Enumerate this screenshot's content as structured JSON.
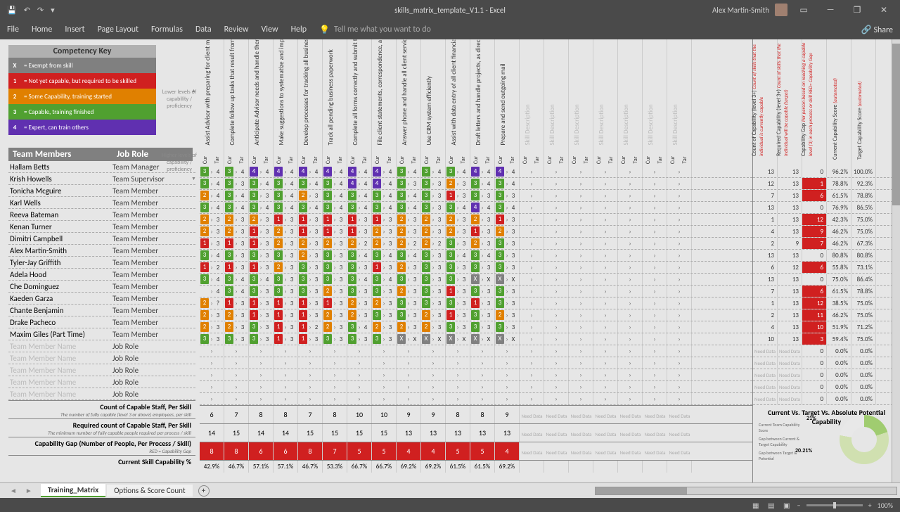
{
  "app": {
    "title": "skills_matrix_template_V1.1 - Excel",
    "user": "Alex Martin-Smith"
  },
  "qat": {
    "save": "💾",
    "undo": "↶",
    "redo": "↷"
  },
  "win": {
    "min": "—",
    "max": "❐",
    "close": "✕",
    "opts": "▭"
  },
  "ribbon": {
    "tabs": [
      "File",
      "Home",
      "Insert",
      "Page Layout",
      "Formulas",
      "Data",
      "Review",
      "View",
      "Help"
    ],
    "tell": "Tell me what you want to do",
    "share": "Share"
  },
  "key": {
    "header": "Competency Key",
    "rows": [
      {
        "n": "X",
        "txt": "= Exempt from skill"
      },
      {
        "n": "1",
        "txt": "= Not yet capable, but required to be skilled"
      },
      {
        "n": "2",
        "txt": "= Some Capability, training started"
      },
      {
        "n": "3",
        "txt": "= Capable, training finished"
      },
      {
        "n": "4",
        "txt": "= Expert, can train others"
      }
    ],
    "prof_low": "Lower levels of capability / proficiency",
    "prof_high": "Higher levels of capability / proficiency"
  },
  "members_hdr": {
    "c1": "Team Members",
    "c2": "Job Role"
  },
  "members": [
    {
      "name": "Hallam Betts",
      "role": "Team Manager"
    },
    {
      "name": "Krish Howells",
      "role": "Team Supervisor"
    },
    {
      "name": "Tonicha Mcguire",
      "role": "Team Member"
    },
    {
      "name": "Karl Wells",
      "role": "Team Member"
    },
    {
      "name": "Reeva Bateman",
      "role": "Team Member"
    },
    {
      "name": "Kenan Turner",
      "role": "Team Member"
    },
    {
      "name": "Dimitri Campbell",
      "role": "Team Member"
    },
    {
      "name": "Alex Martin-Smith",
      "role": "Team Member"
    },
    {
      "name": "Tyler-Jay Griffith",
      "role": "Team Member"
    },
    {
      "name": "Adela Hood",
      "role": "Team Member"
    },
    {
      "name": "Che Dominguez",
      "role": "Team Member"
    },
    {
      "name": "Kaeden Garza",
      "role": "Team Member"
    },
    {
      "name": "Chante Benjamin",
      "role": "Team Member"
    },
    {
      "name": "Drake Pacheco",
      "role": "Team Member"
    },
    {
      "name": "Maxim Giles (Part Time)",
      "role": "Team Member"
    }
  ],
  "placeholder_member": "Team Member Name",
  "placeholder_role": "Job Role",
  "skills": [
    "Assist Advisor with preparing for client meetings",
    "Complete follow up tasks that result from Client meetings",
    "Anticipate Advisor needs and handle them proactively",
    "Make suggestions to systematize and improve office functions",
    "Develop processes for tracking all business and handling paperwork",
    "Track all pending business paperwork",
    "Complete all forms correctly and submit them within one business day",
    "File client statements, correspondence, and agreements",
    "Answer phone and handle all client service issues within capacity",
    "Use CRM system efficiently",
    "Assist with data entry of all client financial information",
    "Draft letters and handle projects, as directed by Advisor",
    "Prepare and send outgoing mail"
  ],
  "skill_placeholder": "Skill Description",
  "curt": {
    "c": "Cur",
    "t": "Tar"
  },
  "matrix": [
    [
      {
        "c": 3,
        "t": 4
      },
      {
        "c": 3,
        "t": 4
      },
      {
        "c": 4,
        "t": 4
      },
      {
        "c": 4,
        "t": 4
      },
      {
        "c": 4,
        "t": 4
      },
      {
        "c": 4,
        "t": 4
      },
      {
        "c": 4,
        "t": 4
      },
      {
        "c": 4,
        "t": 4
      },
      {
        "c": 3,
        "t": 4
      },
      {
        "c": 3,
        "t": 4
      },
      {
        "c": 3,
        "t": 4
      },
      {
        "c": 4,
        "t": 4
      },
      {
        "c": 4,
        "t": 4
      }
    ],
    [
      {
        "c": 3,
        "t": 4
      },
      {
        "c": 3,
        "t": 3
      },
      {
        "c": 3,
        "t": 4
      },
      {
        "c": 3,
        "t": 4
      },
      {
        "c": 3,
        "t": 4
      },
      {
        "c": 3,
        "t": 4
      },
      {
        "c": 4,
        "t": 4
      },
      {
        "c": 4,
        "t": 4
      },
      {
        "c": 3,
        "t": 3
      },
      {
        "c": 3,
        "t": 3
      },
      {
        "c": 2,
        "t": 3
      },
      {
        "c": 3,
        "t": 4
      },
      {
        "c": 3,
        "t": 4
      }
    ],
    [
      {
        "c": 2,
        "t": 4
      },
      {
        "c": 3,
        "t": 4
      },
      {
        "c": 3,
        "t": 3
      },
      {
        "c": 3,
        "t": 4
      },
      {
        "c": 2,
        "t": 3
      },
      {
        "c": 3,
        "t": 4
      },
      {
        "c": 3,
        "t": 4
      },
      {
        "c": 3,
        "t": 4
      },
      {
        "c": 3,
        "t": 4
      },
      {
        "c": 3,
        "t": 3
      },
      {
        "c": 1,
        "t": 3
      },
      {
        "c": 3,
        "t": 3
      },
      {
        "c": 3,
        "t": 3
      }
    ],
    [
      {
        "c": 3,
        "t": 4
      },
      {
        "c": 3,
        "t": 4
      },
      {
        "c": 3,
        "t": 4
      },
      {
        "c": 3,
        "t": 4
      },
      {
        "c": 3,
        "t": 4
      },
      {
        "c": 3,
        "t": 4
      },
      {
        "c": 3,
        "t": 4
      },
      {
        "c": 3,
        "t": 4
      },
      {
        "c": 3,
        "t": 4
      },
      {
        "c": 3,
        "t": 3
      },
      {
        "c": 3,
        "t": 4
      },
      {
        "c": 4,
        "t": 4
      },
      {
        "c": 3,
        "t": 4
      }
    ],
    [
      {
        "c": 2,
        "t": 3
      },
      {
        "c": 2,
        "t": 3
      },
      {
        "c": 2,
        "t": 3
      },
      {
        "c": 1,
        "t": 3
      },
      {
        "c": 1,
        "t": 3
      },
      {
        "c": 1,
        "t": 3
      },
      {
        "c": 1,
        "t": 3
      },
      {
        "c": 1,
        "t": 3
      },
      {
        "c": 2,
        "t": 3
      },
      {
        "c": 2,
        "t": 3
      },
      {
        "c": 2,
        "t": 3
      },
      {
        "c": 2,
        "t": 3
      },
      {
        "c": 1,
        "t": 3
      }
    ],
    [
      {
        "c": 2,
        "t": 3
      },
      {
        "c": 2,
        "t": 3
      },
      {
        "c": 1,
        "t": 3
      },
      {
        "c": 2,
        "t": 3
      },
      {
        "c": 1,
        "t": 3
      },
      {
        "c": 1,
        "t": 3
      },
      {
        "c": 1,
        "t": 3
      },
      {
        "c": 2,
        "t": 3
      },
      {
        "c": 2,
        "t": 3
      },
      {
        "c": 2,
        "t": 3
      },
      {
        "c": 2,
        "t": 3
      },
      {
        "c": 1,
        "t": 3
      },
      {
        "c": 2,
        "t": 3
      }
    ],
    [
      {
        "c": 1,
        "t": 3
      },
      {
        "c": 1,
        "t": 3
      },
      {
        "c": 1,
        "t": 3
      },
      {
        "c": 2,
        "t": 3
      },
      {
        "c": 2,
        "t": 3
      },
      {
        "c": 2,
        "t": 3
      },
      {
        "c": 2,
        "t": 2
      },
      {
        "c": 2,
        "t": 3
      },
      {
        "c": 2,
        "t": 2
      },
      {
        "c": 2,
        "t": 2
      },
      {
        "c": 3,
        "t": 3
      },
      {
        "c": 2,
        "t": 3
      },
      {
        "c": 3,
        "t": 3
      }
    ],
    [
      {
        "c": 3,
        "t": 4
      },
      {
        "c": 3,
        "t": 3
      },
      {
        "c": 3,
        "t": 3
      },
      {
        "c": 3,
        "t": 3
      },
      {
        "c": 2,
        "t": 3
      },
      {
        "c": 3,
        "t": 3
      },
      {
        "c": 3,
        "t": 4
      },
      {
        "c": 3,
        "t": 4
      },
      {
        "c": 3,
        "t": 4
      },
      {
        "c": 3,
        "t": 3
      },
      {
        "c": 3,
        "t": 4
      },
      {
        "c": 3,
        "t": 4
      },
      {
        "c": 3,
        "t": 3
      }
    ],
    [
      {
        "c": 1,
        "t": 2
      },
      {
        "c": 1,
        "t": 3
      },
      {
        "c": 1,
        "t": 3
      },
      {
        "c": 2,
        "t": 3
      },
      {
        "c": 3,
        "t": 3
      },
      {
        "c": 3,
        "t": 3
      },
      {
        "c": 3,
        "t": 3
      },
      {
        "c": 1,
        "t": 3
      },
      {
        "c": 2,
        "t": 3
      },
      {
        "c": 3,
        "t": 3
      },
      {
        "c": 3,
        "t": 3
      },
      {
        "c": 3,
        "t": 3
      },
      {
        "c": 3,
        "t": 3
      }
    ],
    [
      {
        "c": 3,
        "t": 4
      },
      {
        "c": 3,
        "t": 4
      },
      {
        "c": 3,
        "t": 4
      },
      {
        "c": 3,
        "t": 3
      },
      {
        "c": 3,
        "t": 3
      },
      {
        "c": 3,
        "t": 3
      },
      {
        "c": 3,
        "t": 4
      },
      {
        "c": 3,
        "t": 4
      },
      {
        "c": 3,
        "t": 3
      },
      {
        "c": 3,
        "t": 3
      },
      {
        "c": 3,
        "t": 3
      },
      {
        "c": "X",
        "t": "X"
      },
      {
        "c": "X",
        "t": "X"
      }
    ],
    [
      {
        "c": "",
        "t": 4
      },
      {
        "c": 3,
        "t": 4
      },
      {
        "c": 3,
        "t": 3
      },
      {
        "c": 3,
        "t": 3
      },
      {
        "c": 3,
        "t": 3
      },
      {
        "c": 2,
        "t": 3
      },
      {
        "c": 3,
        "t": 3
      },
      {
        "c": 3,
        "t": 3
      },
      {
        "c": 2,
        "t": 3
      },
      {
        "c": 3,
        "t": 3
      },
      {
        "c": 1,
        "t": 3
      },
      {
        "c": 3,
        "t": 3
      },
      {
        "c": 3,
        "t": 3
      }
    ],
    [
      {
        "c": 2,
        "t": "?"
      },
      {
        "c": 1,
        "t": 3
      },
      {
        "c": 1,
        "t": 3
      },
      {
        "c": 1,
        "t": 3
      },
      {
        "c": 1,
        "t": 3
      },
      {
        "c": 1,
        "t": 3
      },
      {
        "c": 2,
        "t": 3
      },
      {
        "c": 2,
        "t": 3
      },
      {
        "c": 3,
        "t": 3
      },
      {
        "c": 3,
        "t": 3
      },
      {
        "c": 3,
        "t": 3
      },
      {
        "c": 1,
        "t": 3
      },
      {
        "c": 3,
        "t": 3
      }
    ],
    [
      {
        "c": 2,
        "t": 3
      },
      {
        "c": 2,
        "t": 3
      },
      {
        "c": 1,
        "t": 3
      },
      {
        "c": 1,
        "t": 3
      },
      {
        "c": 1,
        "t": 3
      },
      {
        "c": 2,
        "t": 3
      },
      {
        "c": 2,
        "t": 3
      },
      {
        "c": 3,
        "t": 3
      },
      {
        "c": 3,
        "t": 3
      },
      {
        "c": 2,
        "t": 3
      },
      {
        "c": 1,
        "t": 3
      },
      {
        "c": 3,
        "t": 3
      },
      {
        "c": 2,
        "t": 3
      }
    ],
    [
      {
        "c": 2,
        "t": 3
      },
      {
        "c": 2,
        "t": 3
      },
      {
        "c": 3,
        "t": 3
      },
      {
        "c": 1,
        "t": 3
      },
      {
        "c": 1,
        "t": 2
      },
      {
        "c": 2,
        "t": 3
      },
      {
        "c": 3,
        "t": 4
      },
      {
        "c": 2,
        "t": 3
      },
      {
        "c": 2,
        "t": 3
      },
      {
        "c": 2,
        "t": 3
      },
      {
        "c": 3,
        "t": 3
      },
      {
        "c": 3,
        "t": 3
      },
      {
        "c": 3,
        "t": 3
      }
    ],
    [
      {
        "c": 3,
        "t": 3
      },
      {
        "c": 3,
        "t": 3
      },
      {
        "c": 3,
        "t": 3
      },
      {
        "c": 1,
        "t": 3
      },
      {
        "c": 1,
        "t": 3
      },
      {
        "c": 3,
        "t": 3
      },
      {
        "c": 3,
        "t": 3
      },
      {
        "c": 3,
        "t": 3
      },
      {
        "c": "X",
        "t": "X"
      },
      {
        "c": "X",
        "t": "X"
      },
      {
        "c": "X",
        "t": "X"
      },
      {
        "c": "X",
        "t": "X"
      },
      {
        "c": "X",
        "t": "X"
      }
    ]
  ],
  "summary_labels": {
    "count": {
      "t": "Count of Capable Staff, Per Skill",
      "s": "The number of fully capable (level 3 or above) employees, per skill"
    },
    "required": {
      "t": "Required count of Capable Staff, Per Skill",
      "s": "The minimum number of fully capable people required per process / skill"
    },
    "gap": {
      "t": "Capability Gap (Number of People, Per Process / Skill)",
      "s": "RED = Capability Gap"
    },
    "pct": {
      "t": "Current Skill Capability %"
    }
  },
  "summary": {
    "count": [
      6,
      7,
      8,
      8,
      7,
      8,
      10,
      10,
      9,
      9,
      8,
      8,
      9
    ],
    "required": [
      14,
      15,
      14,
      14,
      15,
      15,
      15,
      15,
      13,
      13,
      13,
      13,
      13
    ],
    "gap": [
      8,
      8,
      6,
      6,
      8,
      7,
      5,
      5,
      4,
      4,
      5,
      5,
      4
    ],
    "pct": [
      "42.9%",
      "46.7%",
      "57.1%",
      "57.1%",
      "46.7%",
      "53.3%",
      "66.7%",
      "66.7%",
      "69.2%",
      "69.2%",
      "61.5%",
      "61.5%",
      "69.2%"
    ]
  },
  "need_data": "Need Data",
  "right_cols": [
    {
      "m": "Count of Capability (level 3+)",
      "s": "Count of skills that the individual is currently capable"
    },
    {
      "m": "Required Capability (level 3+)",
      "s": "Count of skills that the individual will be capable (target)"
    },
    {
      "m": "Capability Gap",
      "s": "Per person based on reaching a capable level (3) in each process or skill RED= Capability Gap"
    },
    {
      "m": "Current Capability Score",
      "s": "(automated)"
    },
    {
      "m": "Target Capability Score",
      "s": "(automated)"
    }
  ],
  "right_rows": [
    [
      13,
      13,
      0,
      "96.2%",
      "100.0%"
    ],
    [
      12,
      13,
      1,
      "78.8%",
      "92.3%"
    ],
    [
      7,
      13,
      6,
      "61.5%",
      "78.8%"
    ],
    [
      13,
      13,
      0,
      "76.9%",
      "86.5%"
    ],
    [
      1,
      13,
      12,
      "42.3%",
      "75.0%"
    ],
    [
      4,
      13,
      9,
      "46.2%",
      "75.0%"
    ],
    [
      2,
      9,
      7,
      "46.2%",
      "67.3%"
    ],
    [
      13,
      13,
      0,
      "80.8%",
      "80.8%"
    ],
    [
      6,
      12,
      6,
      "55.8%",
      "73.1%"
    ],
    [
      13,
      13,
      0,
      "75.0%",
      "86.4%"
    ],
    [
      7,
      13,
      6,
      "61.5%",
      "78.8%"
    ],
    [
      1,
      13,
      12,
      "38.5%",
      "75.0%"
    ],
    [
      2,
      13,
      11,
      "46.2%",
      "75.0%"
    ],
    [
      4,
      13,
      10,
      "51.9%",
      "71.2%"
    ],
    [
      10,
      13,
      3,
      "59.4%",
      "75.0%"
    ]
  ],
  "right_empty": [
    "Need Data",
    "Need Data",
    0,
    "0.0%",
    "0.0%"
  ],
  "chart": {
    "title": "Current Vs. Target Vs. Absolute Potential Capability",
    "l1": "Current Team Capability Score",
    "l2": "Gap between Current & Target Capability",
    "l3": "Gap between Target & Potential",
    "p1": "21%",
    "p2": "20.21%"
  },
  "chart_data": {
    "type": "pie",
    "title": "Current Vs. Target Vs. Absolute Potential Capability",
    "slices": [
      {
        "name": "Current Team Capability Score",
        "value": 20.21
      },
      {
        "name": "Gap between Current & Target Capability",
        "value": 21
      },
      {
        "name": "Gap between Target & Potential",
        "value": 58.79
      }
    ]
  },
  "sheets": {
    "active": "Training_Matrix",
    "other": "Options & Score Count"
  },
  "status": {
    "zoom": "100%"
  }
}
